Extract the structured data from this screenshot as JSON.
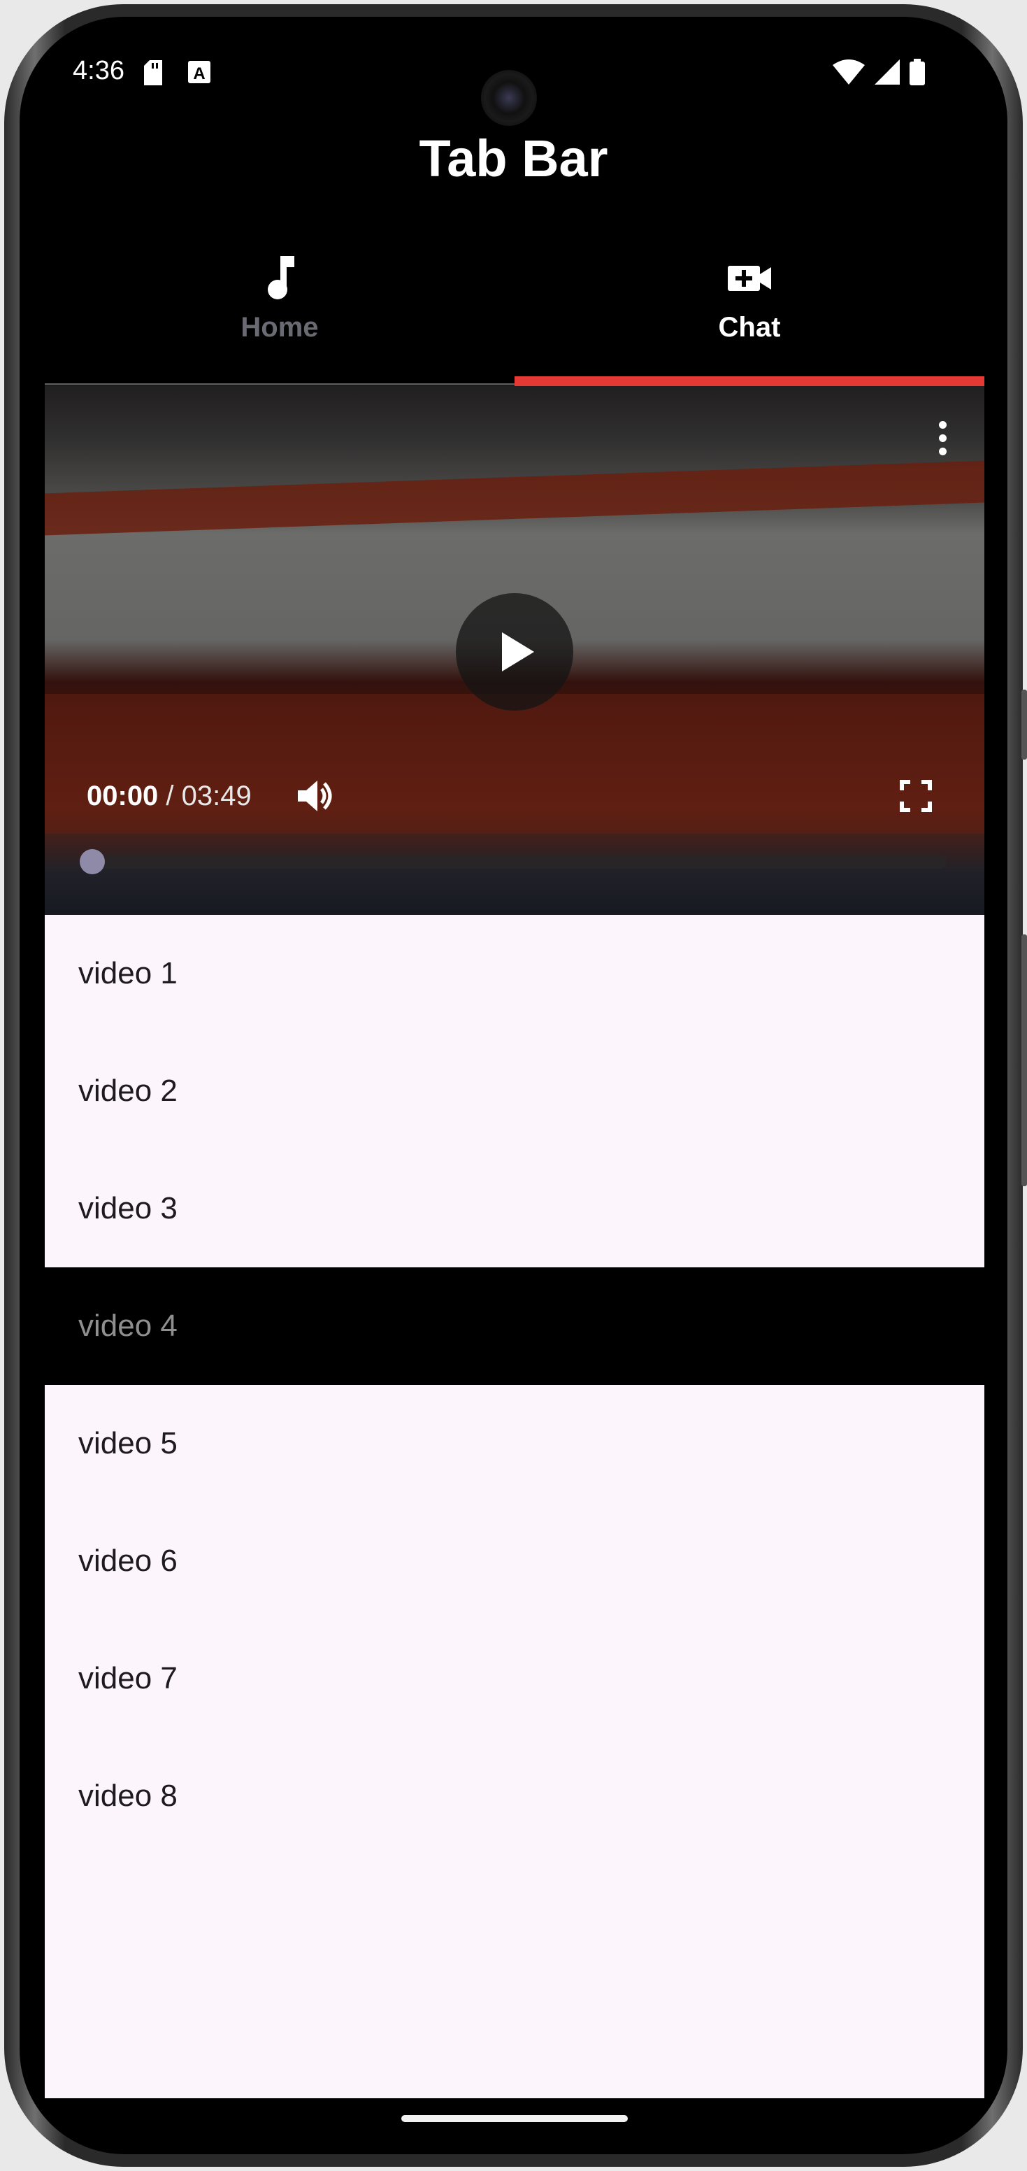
{
  "status_bar": {
    "time": "4:36",
    "icons": [
      "sd-card-icon",
      "keyboard-a-icon",
      "wifi-icon",
      "signal-icon",
      "battery-icon"
    ]
  },
  "app_bar": {
    "title": "Tab Bar"
  },
  "tabs": [
    {
      "label": "Home",
      "icon": "music-note-icon",
      "selected": false
    },
    {
      "label": "Chat",
      "icon": "video-call-icon",
      "selected": true
    }
  ],
  "video_player": {
    "current_time": "00:00",
    "separator": " / ",
    "duration": "03:49",
    "progress": 0,
    "controls": [
      "more-vert-icon",
      "play-icon",
      "volume-icon",
      "fullscreen-icon"
    ]
  },
  "video_list": [
    {
      "label": "video 1",
      "selected": false
    },
    {
      "label": "video 2",
      "selected": false
    },
    {
      "label": "video 3",
      "selected": false
    },
    {
      "label": "video 4",
      "selected": true
    },
    {
      "label": "video 5",
      "selected": false
    },
    {
      "label": "video 6",
      "selected": false
    },
    {
      "label": "video 7",
      "selected": false
    },
    {
      "label": "video 8",
      "selected": false
    }
  ],
  "colors": {
    "accent": "#e53935",
    "list_background": "#fcf5fb",
    "selected_row": "#000000"
  }
}
